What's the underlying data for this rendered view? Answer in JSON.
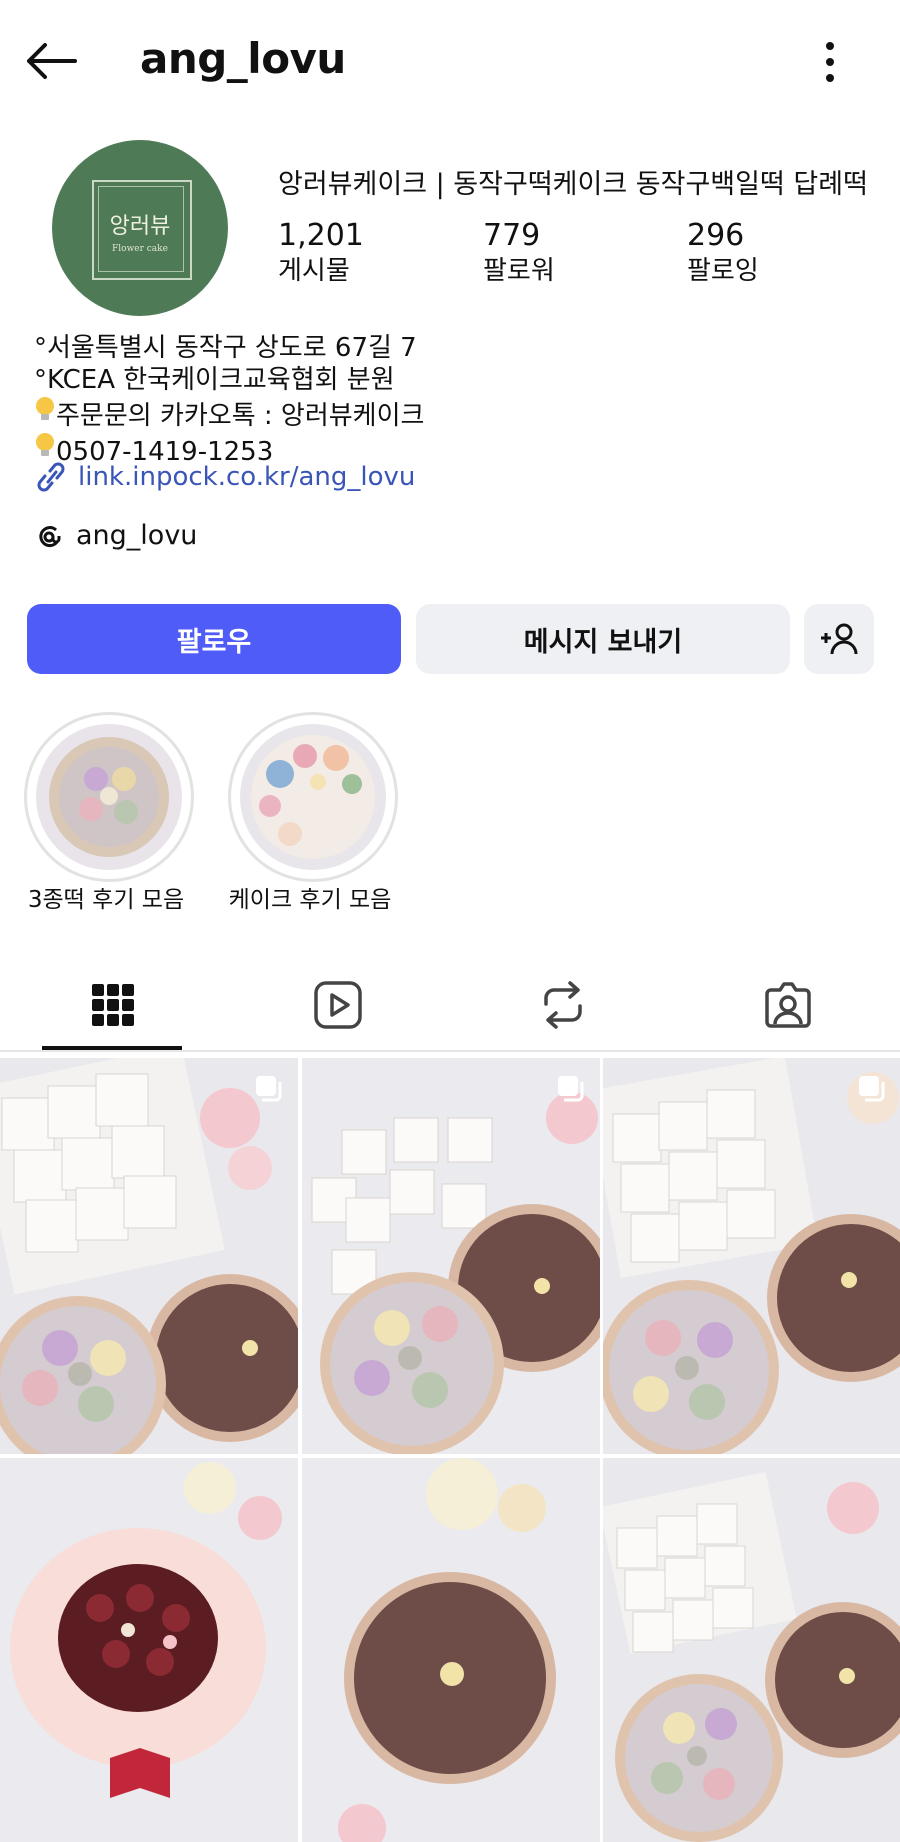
{
  "header": {
    "username": "ang_lovu"
  },
  "profile": {
    "avatar_text": "앙러뷰",
    "avatar_subtext": "Flower cake",
    "display_name": "앙러뷰케이크 | 동작구떡케이크 동작구백일떡 답례떡",
    "stats": [
      {
        "value": "1,201",
        "label": "게시물"
      },
      {
        "value": "779",
        "label": "팔로워"
      },
      {
        "value": "296",
        "label": "팔로잉"
      }
    ],
    "bio": [
      "°서울특별시 동작구 상도로 67길 7",
      "°KCEA 한국케이크교육협회 분원",
      "주문문의 카카오톡 : 앙러뷰케이크",
      "0507-1419-1253"
    ],
    "link": "link.inpock.co.kr/ang_lovu",
    "threads": "ang_lovu"
  },
  "actions": {
    "follow": "팔로우",
    "message": "메시지 보내기"
  },
  "highlights": [
    {
      "label": "3종떡 후기 모음"
    },
    {
      "label": "케이크 후기 모음"
    }
  ],
  "tabs": [
    "grid-icon",
    "reels-icon",
    "reposts-icon",
    "tagged-icon"
  ],
  "colors": {
    "accent": "#4f5cf7",
    "link": "#3a55b8",
    "avatar_bg": "#4e7a56"
  }
}
